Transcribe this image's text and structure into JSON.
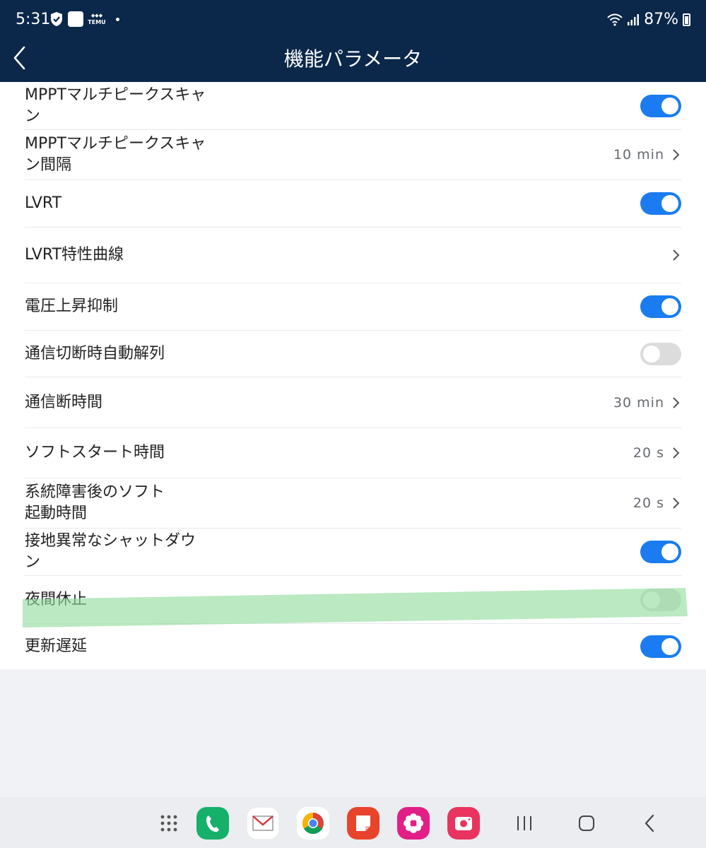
{
  "status_bar": {
    "time": "5:31",
    "temu_label": "TEMU",
    "battery": "87%"
  },
  "header": {
    "title": "機能パラメータ"
  },
  "rows": [
    {
      "label": "MPPTマルチピークスキャン",
      "type": "toggle",
      "on": true
    },
    {
      "label": "MPPTマルチピークスキャン間隔",
      "type": "value",
      "value": "10 min"
    },
    {
      "label": "LVRT",
      "type": "toggle",
      "on": true
    },
    {
      "label": "LVRT特性曲線",
      "type": "link"
    },
    {
      "label": "電圧上昇抑制",
      "type": "toggle",
      "on": true
    },
    {
      "label": "通信切断時自動解列",
      "type": "toggle",
      "on": false
    },
    {
      "label": "通信断時間",
      "type": "value",
      "value": "30 min"
    },
    {
      "label": "ソフトスタート時間",
      "type": "value",
      "value": "20 s"
    },
    {
      "label": "系統障害後のソフト起動時間",
      "type": "value",
      "value": "20 s"
    },
    {
      "label": "接地異常なシャットダウン",
      "type": "toggle",
      "on": true
    },
    {
      "label": "夜間休止",
      "type": "toggle",
      "on": false
    },
    {
      "label": "更新遅延",
      "type": "toggle",
      "on": true
    }
  ],
  "colors": {
    "header_bg": "#0b274a",
    "toggle_on": "#1a7cf0",
    "toggle_off": "#dcdcdc",
    "highlight": "#8fdc9c"
  },
  "dock_icons": [
    "apps-grid-icon",
    "phone-icon",
    "mail-icon",
    "chrome-icon",
    "notes-icon",
    "flower-icon",
    "camera-icon"
  ],
  "nav_icons": [
    "recents-icon",
    "home-icon",
    "back-icon"
  ]
}
